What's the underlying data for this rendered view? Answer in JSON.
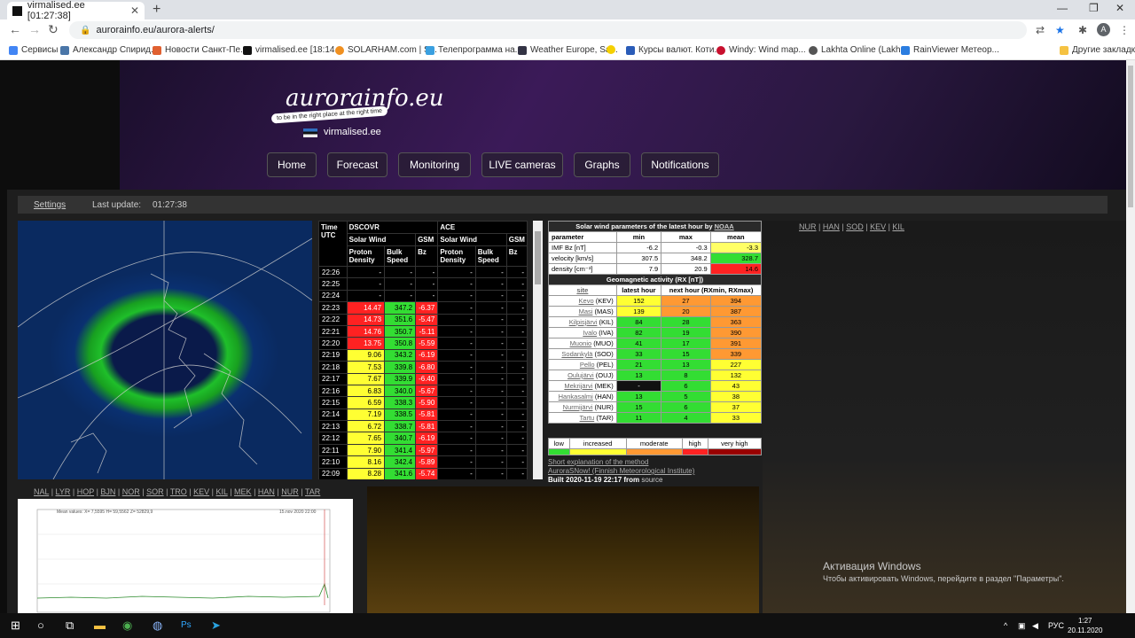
{
  "browser": {
    "tab_title": "virmalised.ee [01:27:38]",
    "url": "aurorainfo.eu/aurora-alerts/",
    "bookmarks": [
      "Сервисы",
      "Александр Спирид...",
      "Новости Санкт-Пе...",
      "virmalised.ee [18:14...",
      "SOLARHAM.com | S...",
      "Телепрограмма на...",
      "Weather Europe, Sa...",
      "",
      "Курсы валют. Коти...",
      "Windy: Wind map...",
      "Lakhta Online (Lakh...",
      "RainViewer Метеор..."
    ],
    "other_bookmarks": "Другие закладки",
    "avatar": "A"
  },
  "site": {
    "logo": "aurorainfo.eu",
    "tagline": "to be in the right place at the right time",
    "subsite": "virmalised.ee",
    "nav": [
      "Home",
      "Forecast",
      "Monitoring",
      "LIVE cameras",
      "Graphs",
      "Notifications"
    ]
  },
  "status": {
    "settings": "Settings",
    "last_update_label": "Last update:",
    "last_update": "01:27:38"
  },
  "dscovr": {
    "h_time": "Time UTC",
    "h_dscovr": "DSCOVR",
    "h_ace": "ACE",
    "h_sw": "Solar Wind",
    "h_gsm": "GSM",
    "h_sw2": "Solar Wind",
    "h_gsm2": "GSM",
    "h_pd": "Proton Density",
    "h_bs": "Bulk Speed",
    "h_bz": "Bz",
    "h_pd2": "Proton Density",
    "h_bs2": "Bulk Speed",
    "h_bz2": "Bz",
    "rows": [
      [
        "22:26",
        "-",
        "-",
        "-",
        "-",
        "-",
        "-"
      ],
      [
        "22:25",
        "-",
        "-",
        "-",
        "-",
        "-",
        "-"
      ],
      [
        "22:24",
        "-",
        "-",
        "-",
        "-",
        "-",
        "-"
      ],
      [
        "22:23",
        "14.47",
        "347.2",
        "-6.37",
        "-",
        "-",
        "-"
      ],
      [
        "22:22",
        "14.73",
        "351.6",
        "-5.47",
        "-",
        "-",
        "-"
      ],
      [
        "22:21",
        "14.76",
        "350.7",
        "-5.11",
        "-",
        "-",
        "-"
      ],
      [
        "22:20",
        "13.75",
        "350.8",
        "-5.59",
        "-",
        "-",
        "-"
      ],
      [
        "22:19",
        "9.06",
        "343.2",
        "-6.19",
        "-",
        "-",
        "-"
      ],
      [
        "22:18",
        "7.53",
        "339.8",
        "-6.80",
        "-",
        "-",
        "-"
      ],
      [
        "22:17",
        "7.67",
        "339.9",
        "-6.40",
        "-",
        "-",
        "-"
      ],
      [
        "22:16",
        "6.83",
        "340.0",
        "-5.67",
        "-",
        "-",
        "-"
      ],
      [
        "22:15",
        "6.59",
        "338.3",
        "-5.90",
        "-",
        "-",
        "-"
      ],
      [
        "22:14",
        "7.19",
        "338.5",
        "-5.81",
        "-",
        "-",
        "-"
      ],
      [
        "22:13",
        "6.72",
        "338.7",
        "-5.81",
        "-",
        "-",
        "-"
      ],
      [
        "22:12",
        "7.65",
        "340.7",
        "-6.19",
        "-",
        "-",
        "-"
      ],
      [
        "22:11",
        "7.90",
        "341.4",
        "-5.97",
        "-",
        "-",
        "-"
      ],
      [
        "22:10",
        "8.16",
        "342.4",
        "-5.89",
        "-",
        "-",
        "-"
      ],
      [
        "22:09",
        "8.28",
        "341.6",
        "-5.74",
        "-",
        "-",
        "-"
      ]
    ]
  },
  "solarwind": {
    "title": "Solar wind parameters of the latest hour by",
    "title_link": "NOAA",
    "cols": [
      "parameter",
      "min",
      "max",
      "mean"
    ],
    "rows": [
      {
        "p": "IMF Bz [nT]",
        "min": "-6.2",
        "max": "-0.3",
        "mean": "-3.3",
        "c": "#ffff66"
      },
      {
        "p": "velocity [km/s]",
        "min": "307.5",
        "max": "348.2",
        "mean": "328.7",
        "c": "#33dd33"
      },
      {
        "p": "density [cm⁻³]",
        "min": "7.9",
        "max": "20.9",
        "mean": "14.6",
        "c": "#ff2222"
      }
    ],
    "geo_title": "Geomagnetic activity (RX [nT])",
    "geo_cols": [
      "site",
      "latest hour",
      "next hour (RXmin, RXmax)"
    ],
    "sites": [
      {
        "n": "Kevo",
        "c": "(KEV)",
        "a": "152",
        "b": "27",
        "d": "394",
        "ca": "#ffff33",
        "cb": "#ff9933",
        "cd": "#ff9933"
      },
      {
        "n": "Masi",
        "c": "(MAS)",
        "a": "139",
        "b": "20",
        "d": "387",
        "ca": "#ffff33",
        "cb": "#ff9933",
        "cd": "#ff9933"
      },
      {
        "n": "Kilpisjärvi",
        "c": "(KIL)",
        "a": "84",
        "b": "28",
        "d": "363",
        "ca": "#33dd33",
        "cb": "#33dd33",
        "cd": "#ff9933"
      },
      {
        "n": "Ivalo",
        "c": "(IVA)",
        "a": "82",
        "b": "19",
        "d": "390",
        "ca": "#33dd33",
        "cb": "#33dd33",
        "cd": "#ff9933"
      },
      {
        "n": "Muonio",
        "c": "(MUO)",
        "a": "41",
        "b": "17",
        "d": "391",
        "ca": "#33dd33",
        "cb": "#33dd33",
        "cd": "#ff9933"
      },
      {
        "n": "Sodankylä",
        "c": "(SOD)",
        "a": "33",
        "b": "15",
        "d": "339",
        "ca": "#33dd33",
        "cb": "#33dd33",
        "cd": "#ff9933"
      },
      {
        "n": "Pello",
        "c": "(PEL)",
        "a": "21",
        "b": "13",
        "d": "227",
        "ca": "#33dd33",
        "cb": "#33dd33",
        "cd": "#ffff33"
      },
      {
        "n": "Oulujärvi",
        "c": "(OUJ)",
        "a": "13",
        "b": "8",
        "d": "132",
        "ca": "#33dd33",
        "cb": "#33dd33",
        "cd": "#ffff33"
      },
      {
        "n": "Mekrijärvi",
        "c": "(MEK)",
        "a": "-",
        "b": "6",
        "d": "43",
        "ca": "#111111",
        "cb": "#33dd33",
        "cd": "#ffff33"
      },
      {
        "n": "Hankasalmi",
        "c": "(HAN)",
        "a": "13",
        "b": "5",
        "d": "38",
        "ca": "#33dd33",
        "cb": "#33dd33",
        "cd": "#ffff33"
      },
      {
        "n": "Nurmijärvi",
        "c": "(NUR)",
        "a": "15",
        "b": "6",
        "d": "37",
        "ca": "#33dd33",
        "cb": "#33dd33",
        "cd": "#ffff33"
      },
      {
        "n": "Tartu",
        "c": "(TAR)",
        "a": "11",
        "b": "4",
        "d": "33",
        "ca": "#33dd33",
        "cb": "#33dd33",
        "cd": "#ffff33"
      }
    ],
    "legend": [
      "low",
      "increased",
      "moderate",
      "high",
      "very high"
    ],
    "legend_colors": [
      "#33dd33",
      "#ffff33",
      "#ff9933",
      "#ff2222",
      "#990000"
    ]
  },
  "footer": {
    "l1": "Short explanation of the method",
    "l2": "AuroraSNow! (Finnish Meteorological Institute)",
    "built": "Built 2020-11-19 22:17 from",
    "source": "source"
  },
  "sitelinks": [
    "NUR",
    "HAN",
    "SOD",
    "KEV",
    "KIL"
  ],
  "stations": [
    "NAL",
    "LYR",
    "HOP",
    "BJN",
    "NOR",
    "SOR",
    "TRO",
    "KEV",
    "KIL",
    "MEK",
    "HAN",
    "NUR",
    "TAR"
  ],
  "magneto": {
    "legend": "Mean values:  X= 7,5595   H= 59,5562   Z= 52829,9",
    "date": "15.nov 2020 22:00"
  },
  "windows": {
    "act1": "Активация Windows",
    "act2": "Чтобы активировать Windows, перейдите в раздел \"Параметры\".",
    "lang": "РУС",
    "time": "1:27",
    "date": "20.11.2020"
  }
}
